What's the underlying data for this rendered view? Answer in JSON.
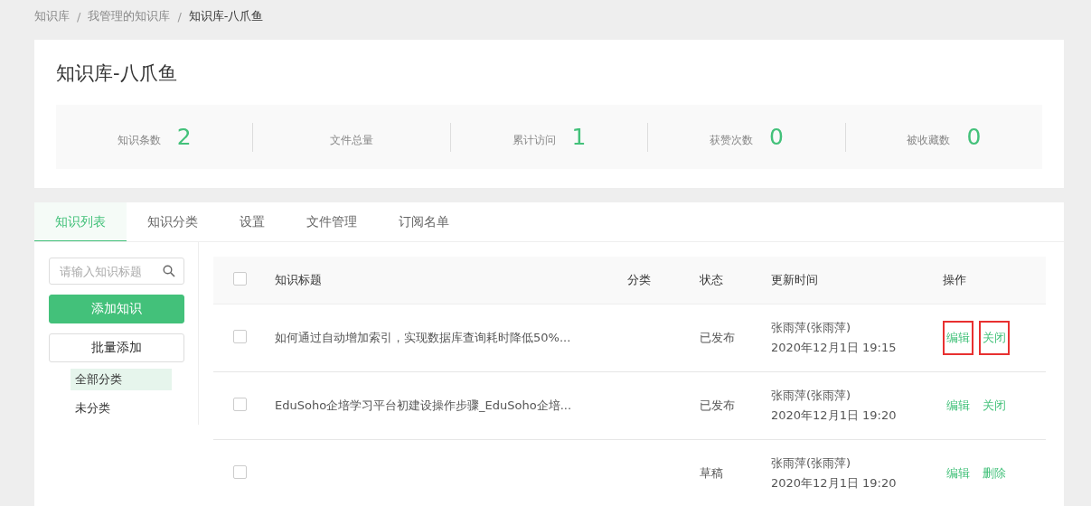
{
  "breadcrumb": [
    {
      "label": "知识库",
      "current": false
    },
    {
      "label": "我管理的知识库",
      "current": false
    },
    {
      "label": "知识库-八爪鱼",
      "current": true
    }
  ],
  "breadcrumb_separator": "/",
  "title": "知识库-八爪鱼",
  "stats": [
    {
      "label": "知识条数",
      "value": "2"
    },
    {
      "label": "文件总量"
    },
    {
      "label": "累计访问",
      "value": "1"
    },
    {
      "label": "获赞次数",
      "value": "0"
    },
    {
      "label": "被收藏数",
      "value": "0"
    }
  ],
  "tabs": [
    {
      "label": "知识列表",
      "selected": true
    },
    {
      "label": "知识分类",
      "selected": false
    },
    {
      "label": "设置",
      "selected": false
    },
    {
      "label": "文件管理",
      "selected": false
    },
    {
      "label": "订阅名单",
      "selected": false
    }
  ],
  "search": {
    "placeholder": "请输入知识标题"
  },
  "buttons": [
    {
      "label": "添加知识",
      "kind": "primary"
    },
    {
      "label": "批量添加",
      "kind": "default"
    }
  ],
  "categories": [
    {
      "label": "全部分类",
      "selected": true
    },
    {
      "label": "未分类",
      "selected": false
    }
  ],
  "table": {
    "select_all_checked": false,
    "columns": [
      "知识标题",
      "分类",
      "状态",
      "更新时间",
      "操作"
    ],
    "rows": [
      {
        "checked": false,
        "title": "如何通过自动增加索引，实现数据库查询耗时降低50%...",
        "status": "已发布",
        "author": "张雨萍(张雨萍)",
        "time": "2020年12月1日 19:15",
        "actions": [
          {
            "label": "编辑",
            "highlighted": true
          },
          {
            "label": "关闭",
            "highlighted": true
          }
        ]
      },
      {
        "checked": false,
        "title": "EduSoho企培学习平台初建设操作步骤_EduSoho企培...",
        "status": "已发布",
        "author": "张雨萍(张雨萍)",
        "time": "2020年12月1日 19:20",
        "actions": [
          {
            "label": "编辑",
            "highlighted": false
          },
          {
            "label": "关闭",
            "highlighted": false
          }
        ]
      },
      {
        "checked": false,
        "status": "草稿",
        "author": "张雨萍(张雨萍)",
        "time": "2020年12月1日 19:20",
        "actions": [
          {
            "label": "编辑",
            "highlighted": false
          },
          {
            "label": "删除",
            "highlighted": false
          }
        ]
      }
    ]
  }
}
